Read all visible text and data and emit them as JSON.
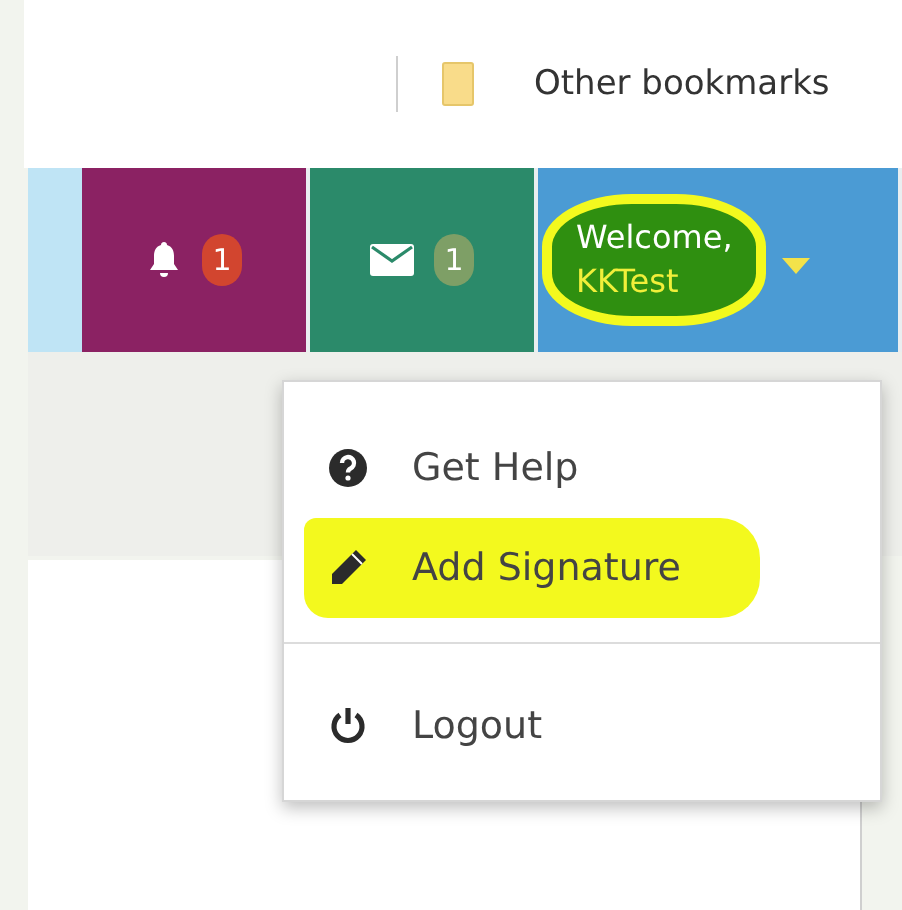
{
  "bookmarks_bar": {
    "folder": "Other bookmarks"
  },
  "nav": {
    "notifications": {
      "count": "1"
    },
    "messages": {
      "count": "1"
    },
    "user": {
      "greeting": "Welcome,",
      "name": "KKTest",
      "highlighted": true,
      "expanded": true
    }
  },
  "menu": [
    {
      "kind": "help",
      "label": "Get Help",
      "highlighted": false
    },
    {
      "kind": "edit",
      "label": "Add Signature",
      "highlighted": true
    },
    {
      "kind": "logout",
      "label": "Logout",
      "highlighted": false
    }
  ]
}
